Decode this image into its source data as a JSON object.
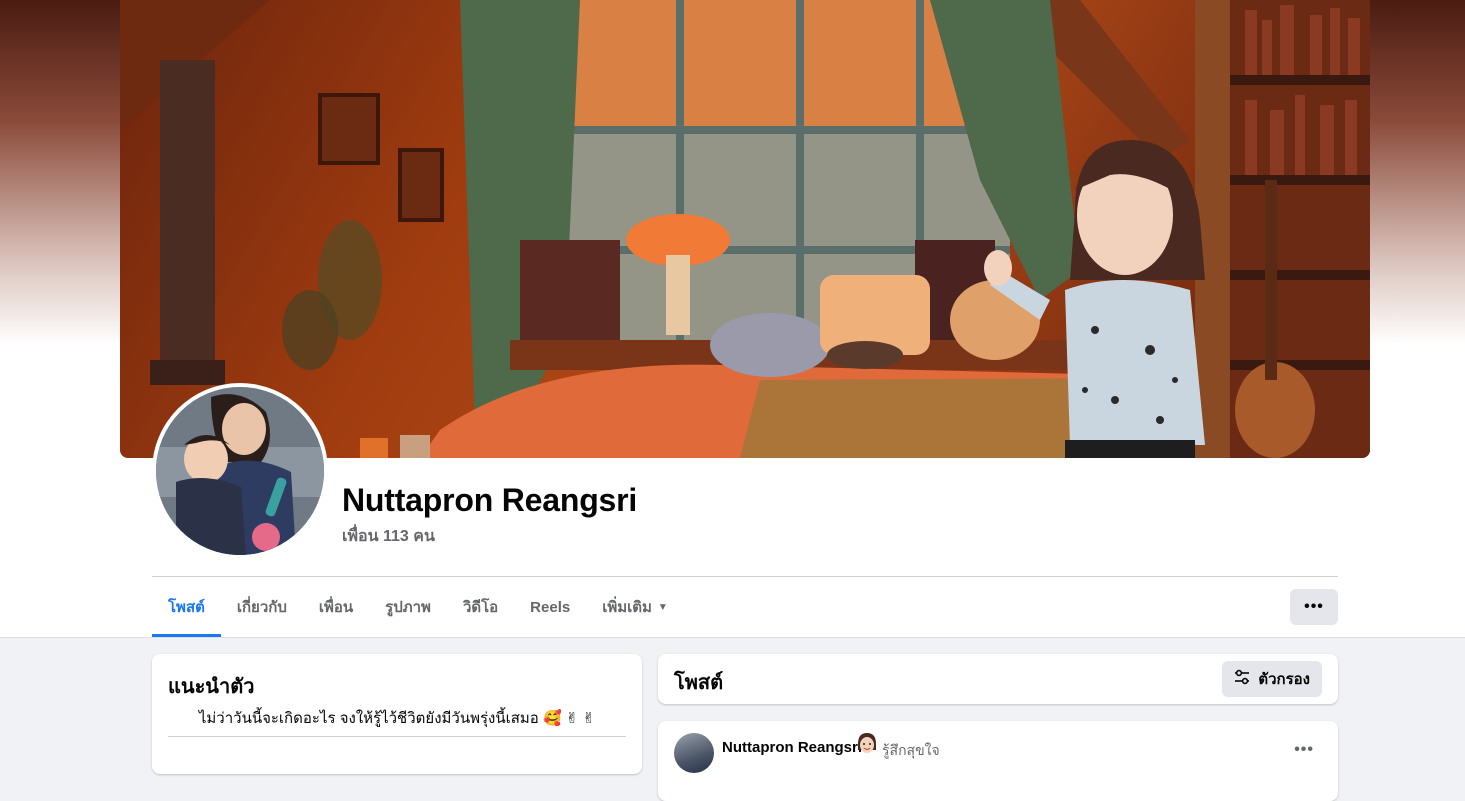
{
  "profile": {
    "name": "Nuttapron Reangsri",
    "friends": "เพื่อน 113 คน"
  },
  "tabs": [
    {
      "label": "โพสต์",
      "active": true
    },
    {
      "label": "เกี่ยวกับ",
      "active": false
    },
    {
      "label": "เพื่อน",
      "active": false
    },
    {
      "label": "รูปภาพ",
      "active": false
    },
    {
      "label": "วิดีโอ",
      "active": false
    },
    {
      "label": "Reels",
      "active": false
    },
    {
      "label": "เพิ่มเติม",
      "active": false
    }
  ],
  "more_button": "•••",
  "intro": {
    "title": "แนะนำตัว",
    "bio": "ไม่ว่าวันนี้จะเกิดอะไร จงให้รู้ไว้ชีวิตยังมีวันพรุ่งนี้เสมอ 🥰 ✌ ✌"
  },
  "posts": {
    "title": "โพสต์",
    "filter_label": "ตัวกรอง"
  },
  "post": {
    "author": "Nuttapron Reangsri",
    "feeling": "รู้สึกสุขใจ",
    "more": "•••"
  },
  "colors": {
    "accent": "#1877f2",
    "secondary_text": "#65676b",
    "button_bg": "#e4e6eb",
    "page_bg": "#f0f2f5"
  }
}
